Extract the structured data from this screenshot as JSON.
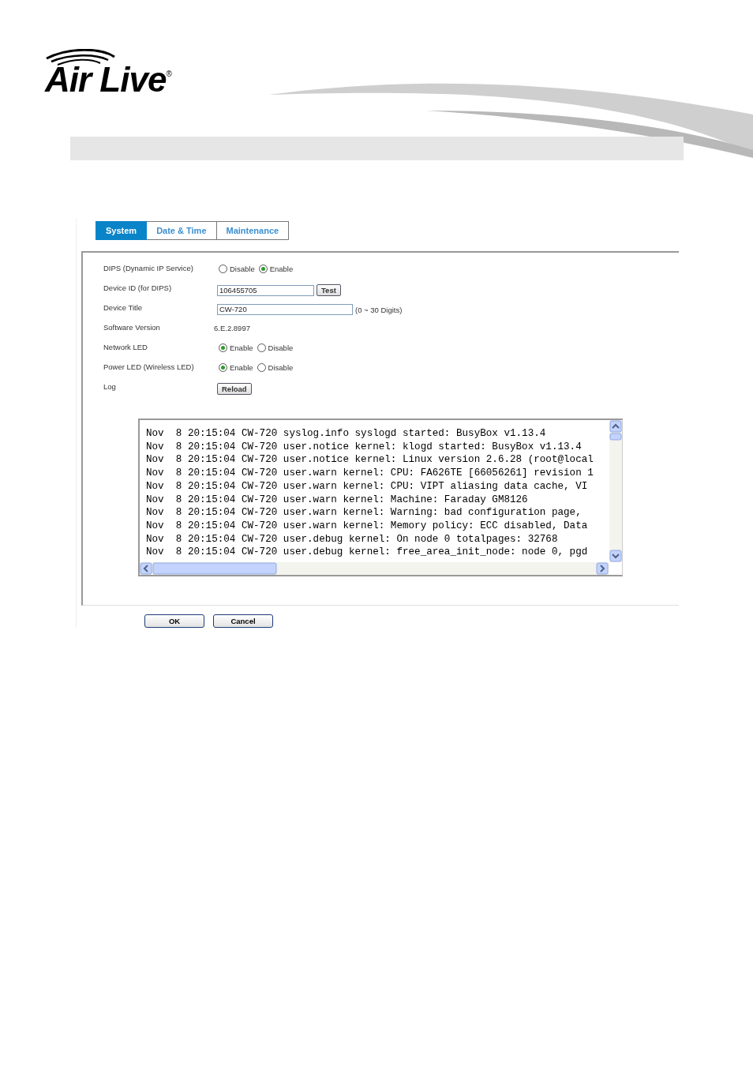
{
  "logo": {
    "text": "Air Live",
    "mark": "®"
  },
  "tabs": [
    {
      "label": "System",
      "selected": true
    },
    {
      "label": "Date & Time",
      "selected": false
    },
    {
      "label": "Maintenance",
      "selected": false
    }
  ],
  "form": [
    {
      "kind": "radio",
      "label": "DIPS (Dynamic IP Service)",
      "options": [
        {
          "label": "Disable",
          "selected": false
        },
        {
          "label": "Enable",
          "selected": true
        }
      ]
    },
    {
      "kind": "input",
      "label": "Device ID (for DIPS)",
      "value": "106455705",
      "button": "Test"
    },
    {
      "kind": "input",
      "label": "Device Title",
      "value": "CW-720",
      "hint": "(0 ~ 30 Digits)"
    },
    {
      "kind": "text",
      "label": "Software Version",
      "value": "6.E.2.8997"
    },
    {
      "kind": "radio",
      "label": "Network LED",
      "options": [
        {
          "label": "Enable",
          "selected": true
        },
        {
          "label": "Disable",
          "selected": false
        }
      ]
    },
    {
      "kind": "radio",
      "label": "Power LED (Wireless LED)",
      "options": [
        {
          "label": "Enable",
          "selected": true
        },
        {
          "label": "Disable",
          "selected": false
        }
      ]
    },
    {
      "kind": "button",
      "label": "Log",
      "button": "Reload"
    }
  ],
  "log": [
    "Nov  8 20:15:04 CW-720 syslog.info syslogd started: BusyBox v1.13.4",
    "Nov  8 20:15:04 CW-720 user.notice kernel: klogd started: BusyBox v1.13.4",
    "Nov  8 20:15:04 CW-720 user.notice kernel: Linux version 2.6.28 (root@local",
    "Nov  8 20:15:04 CW-720 user.warn kernel: CPU: FA626TE [66056261] revision 1",
    "Nov  8 20:15:04 CW-720 user.warn kernel: CPU: VIPT aliasing data cache, VI",
    "Nov  8 20:15:04 CW-720 user.warn kernel: Machine: Faraday GM8126",
    "Nov  8 20:15:04 CW-720 user.warn kernel: Warning: bad configuration page,",
    "Nov  8 20:15:04 CW-720 user.warn kernel: Memory policy: ECC disabled, Data",
    "Nov  8 20:15:04 CW-720 user.debug kernel: On node 0 totalpages: 32768",
    "Nov  8 20:15:04 CW-720 user.debug kernel: free_area_init_node: node 0, pgd"
  ],
  "buttons": [
    "OK",
    "Cancel"
  ]
}
